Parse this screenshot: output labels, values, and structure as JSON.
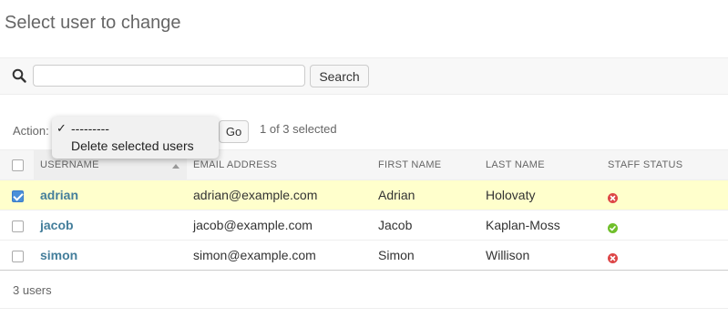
{
  "page": {
    "title": "Select user to change"
  },
  "search": {
    "value": "",
    "placeholder": "",
    "button_label": "Search",
    "icon": "search-icon"
  },
  "actions": {
    "label": "Action:",
    "go_label": "Go",
    "selection_counter": "1 of 3 selected",
    "options": [
      {
        "label": "---------",
        "checked": true,
        "check_mark": "✓"
      },
      {
        "label": "Delete selected users",
        "checked": false,
        "check_mark": ""
      }
    ]
  },
  "table": {
    "headers": [
      "USERNAME",
      "EMAIL ADDRESS",
      "FIRST NAME",
      "LAST NAME",
      "STAFF STATUS"
    ],
    "sorted_column": "USERNAME",
    "sort_direction": "ascending",
    "rows": [
      {
        "selected": true,
        "username": "adrian",
        "email": "adrian@example.com",
        "first_name": "Adrian",
        "last_name": "Holovaty",
        "staff_status": "no",
        "staff_icon": "cross-icon"
      },
      {
        "selected": false,
        "username": "jacob",
        "email": "jacob@example.com",
        "first_name": "Jacob",
        "last_name": "Kaplan-Moss",
        "staff_status": "yes",
        "staff_icon": "check-icon"
      },
      {
        "selected": false,
        "username": "simon",
        "email": "simon@example.com",
        "first_name": "Simon",
        "last_name": "Willison",
        "staff_status": "no",
        "staff_icon": "cross-icon"
      }
    ]
  },
  "paginator": {
    "text": "3 users"
  },
  "colors": {
    "link": "#447e9b",
    "selected_row": "#ffffcc",
    "status_yes": "#70bf2b",
    "status_no": "#dd4646",
    "checkbox_checked": "#4a90d9"
  }
}
